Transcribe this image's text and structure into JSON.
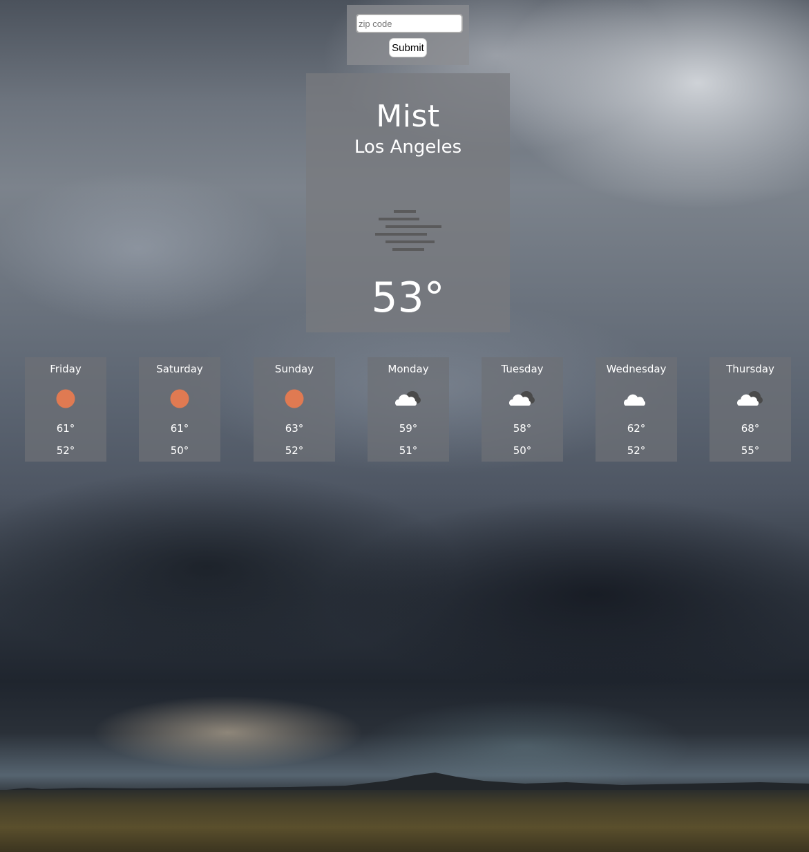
{
  "search": {
    "placeholder": "zip code",
    "value": "",
    "submit_label": "Submit"
  },
  "current": {
    "condition": "Mist",
    "city": "Los Angeles",
    "temperature": "53°",
    "icon": "mist-icon"
  },
  "forecast": [
    {
      "day": "Friday",
      "icon": "sun-icon",
      "high": "61°",
      "low": "52°"
    },
    {
      "day": "Saturday",
      "icon": "sun-icon",
      "high": "61°",
      "low": "50°"
    },
    {
      "day": "Sunday",
      "icon": "sun-icon",
      "high": "63°",
      "low": "52°"
    },
    {
      "day": "Monday",
      "icon": "cloudy-icon",
      "high": "59°",
      "low": "51°"
    },
    {
      "day": "Tuesday",
      "icon": "cloudy-icon",
      "high": "58°",
      "low": "50°"
    },
    {
      "day": "Wednesday",
      "icon": "cloud-icon",
      "high": "62°",
      "low": "52°"
    },
    {
      "day": "Thursday",
      "icon": "cloudy-icon",
      "high": "68°",
      "low": "55°"
    }
  ],
  "colors": {
    "sun": "#e07a52",
    "cloud": "#ffffff",
    "cloud_shadow": "#4a4a4a",
    "mist_lines": "#555555"
  }
}
